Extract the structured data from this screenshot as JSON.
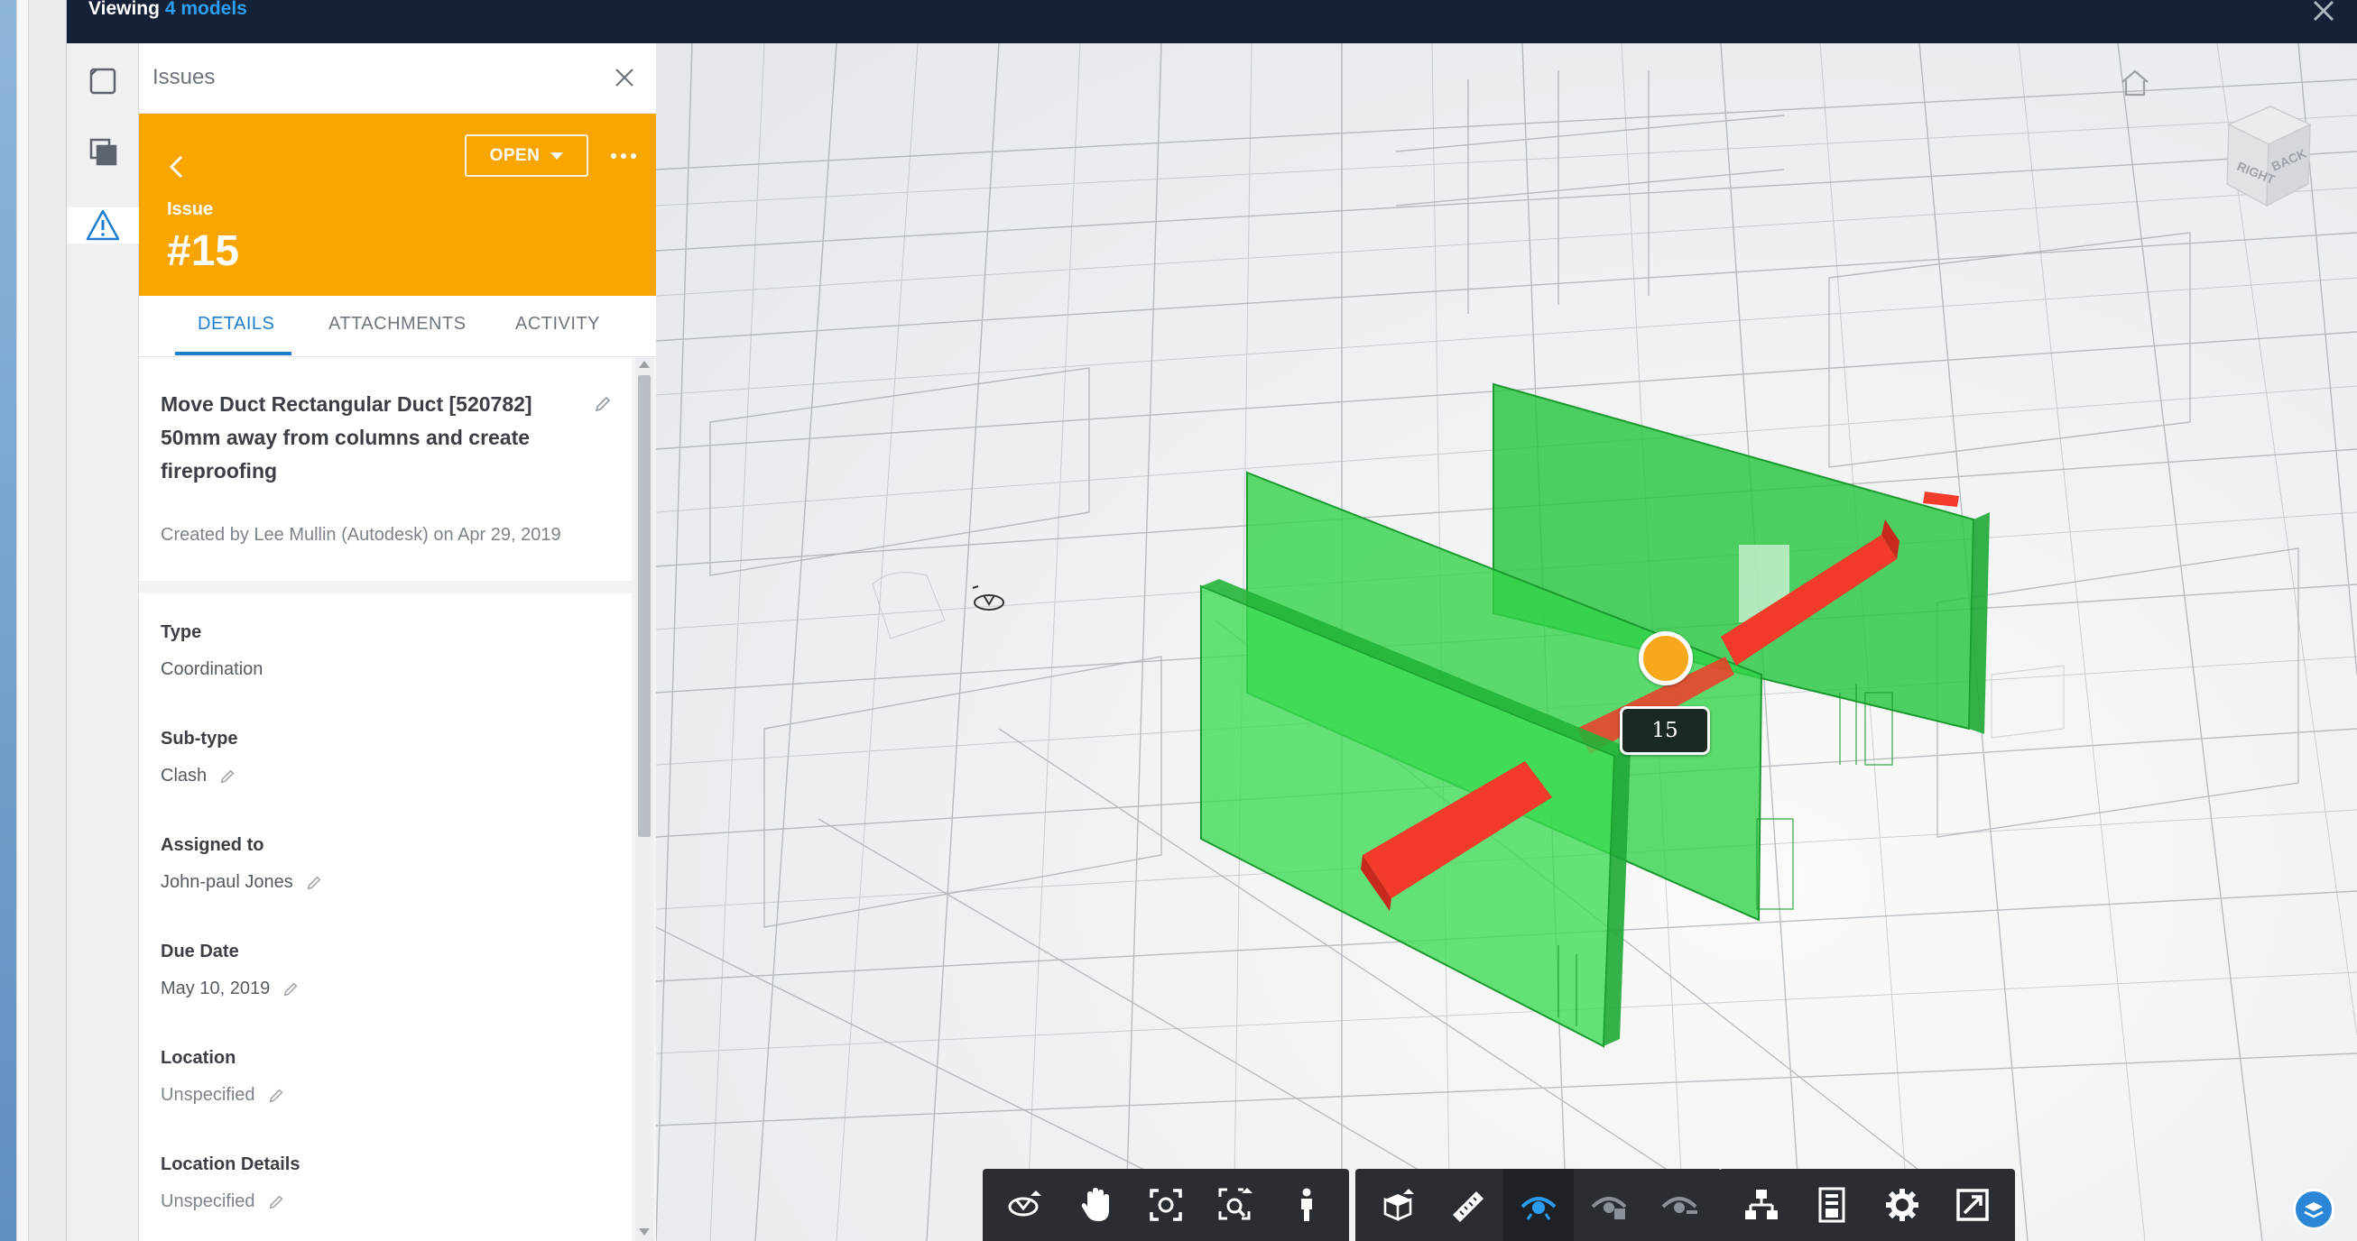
{
  "titlebar": {
    "prefix": "Viewing",
    "accent": "4 models",
    "close_icon": "close-icon"
  },
  "rail": {
    "items": [
      {
        "icon": "model-square-icon"
      },
      {
        "icon": "layers-icon"
      },
      {
        "icon": "warning-triangle-icon",
        "active": true
      }
    ]
  },
  "panel": {
    "title": "Issues"
  },
  "issue": {
    "status": "OPEN",
    "kind_label": "Issue",
    "number": "#15",
    "description": "Move Duct Rectangular Duct [520782] 50mm away from columns and create fireproofing",
    "created": "Created by Lee Mullin (Autodesk) on Apr 29, 2019",
    "accent_color": "#f9a602"
  },
  "tabs": [
    {
      "label": "DETAILS",
      "active": true
    },
    {
      "label": "ATTACHMENTS",
      "active": false
    },
    {
      "label": "ACTIVITY",
      "active": false
    }
  ],
  "fields": {
    "type": {
      "label": "Type",
      "value": "Coordination"
    },
    "subtype": {
      "label": "Sub-type",
      "value": "Clash"
    },
    "assigned": {
      "label": "Assigned to",
      "value": "John-paul Jones"
    },
    "due": {
      "label": "Due Date",
      "value": "May 10, 2019"
    },
    "location": {
      "label": "Location",
      "value": "Unspecified"
    },
    "location_details": {
      "label": "Location Details",
      "value": "Unspecified"
    }
  },
  "viewport": {
    "pin_label": "15",
    "viewcube_faces": [
      "RIGHT",
      "BACK"
    ],
    "clash_colors": {
      "element": "#33d34a",
      "duct": "#f23b2a",
      "pin": "#f7a81b"
    }
  },
  "toolbar": {
    "groups": [
      [
        "orbit-icon",
        "pan-hand-icon",
        "fit-view-icon",
        "zoom-window-icon",
        "first-person-icon"
      ],
      [
        "section-box-icon",
        "measure-ruler-icon",
        "model-browser-eye-icon",
        "hide-icon",
        "isolate-icon"
      ],
      [
        "structure-tree-icon",
        "properties-icon",
        "settings-gear-icon",
        "fullscreen-icon"
      ]
    ],
    "selected": "model-browser-eye-icon"
  }
}
